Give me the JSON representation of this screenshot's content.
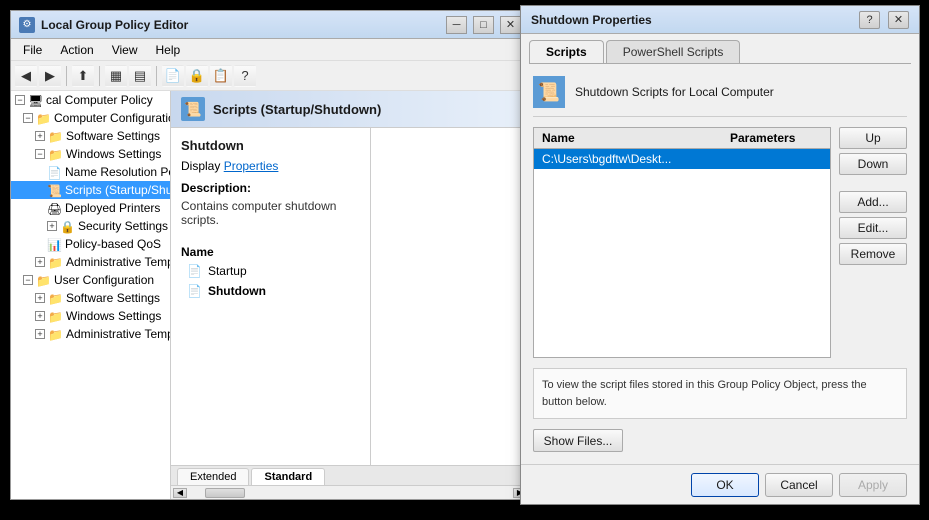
{
  "mainWindow": {
    "title": "Local Group Policy Editor",
    "icon": "⚙"
  },
  "menuBar": {
    "items": [
      "File",
      "Action",
      "View",
      "Help"
    ]
  },
  "toolbar": {
    "buttons": [
      "◀",
      "▶",
      "⬆",
      "📋",
      "⬛",
      "▣",
      "▤",
      "📁",
      "🔒",
      "🔓",
      "👁",
      "🖥"
    ]
  },
  "sidebar": {
    "items": [
      {
        "id": "local-computer-policy",
        "label": "Local Computer Policy",
        "indent": 0,
        "expanded": true,
        "hasTree": false
      },
      {
        "id": "computer-configuration",
        "label": "Computer Configuration",
        "indent": 1,
        "expanded": true,
        "hasTree": true
      },
      {
        "id": "software-settings-computer",
        "label": "Software Settings",
        "indent": 2,
        "expanded": false,
        "hasTree": true
      },
      {
        "id": "windows-settings-computer",
        "label": "Windows Settings",
        "indent": 2,
        "expanded": true,
        "hasTree": true
      },
      {
        "id": "name-resolution",
        "label": "Name Resolution Pol...",
        "indent": 3,
        "expanded": false,
        "hasTree": false
      },
      {
        "id": "scripts",
        "label": "Scripts (Startup/Shu...",
        "indent": 3,
        "expanded": false,
        "hasTree": false,
        "selected": true
      },
      {
        "id": "deployed-printers",
        "label": "Deployed Printers",
        "indent": 3,
        "expanded": false,
        "hasTree": false
      },
      {
        "id": "security-settings",
        "label": "Security Settings",
        "indent": 3,
        "expanded": false,
        "hasTree": true
      },
      {
        "id": "policy-based-qos",
        "label": "Policy-based QoS",
        "indent": 3,
        "expanded": false,
        "hasTree": false
      },
      {
        "id": "admin-templates-computer",
        "label": "Administrative Templat...",
        "indent": 2,
        "expanded": false,
        "hasTree": true
      },
      {
        "id": "user-configuration",
        "label": "User Configuration",
        "indent": 1,
        "expanded": true,
        "hasTree": true
      },
      {
        "id": "software-settings-user",
        "label": "Software Settings",
        "indent": 2,
        "expanded": false,
        "hasTree": true
      },
      {
        "id": "windows-settings-user",
        "label": "Windows Settings",
        "indent": 2,
        "expanded": false,
        "hasTree": true
      },
      {
        "id": "admin-templates-user",
        "label": "Administrative Templat...",
        "indent": 2,
        "expanded": false,
        "hasTree": true
      }
    ]
  },
  "panelHeader": {
    "title": "Scripts (Startup/Shutdown)",
    "icon": "📜"
  },
  "scriptPanel": {
    "sectionTitle": "Shutdown",
    "displayLabel": "Display",
    "propertiesLink": "Properties",
    "descriptionLabel": "Description:",
    "descriptionText": "Contains computer shutdown scripts.",
    "nameLabel": "Name",
    "items": [
      {
        "label": "Startup",
        "icon": "📄"
      },
      {
        "label": "Shutdown",
        "icon": "📄",
        "active": true
      }
    ]
  },
  "statusTabs": [
    {
      "label": "Extended",
      "active": false
    },
    {
      "label": "Standard",
      "active": true
    }
  ],
  "dialog": {
    "title": "Shutdown Properties",
    "helpBtn": "?",
    "closeBtn": "✕",
    "tabs": [
      {
        "label": "Scripts",
        "active": true
      },
      {
        "label": "PowerShell Scripts",
        "active": false
      }
    ],
    "headerLabel": "Shutdown Scripts for Local Computer",
    "headerIcon": "📜",
    "tableColumns": {
      "name": "Name",
      "parameters": "Parameters"
    },
    "tableRows": [
      {
        "name": "C:\\Users\\bgdftw\\Deskt...",
        "parameters": "",
        "selected": true
      }
    ],
    "actionButtons": [
      {
        "label": "Up",
        "disabled": false
      },
      {
        "label": "Down",
        "disabled": false
      },
      {
        "label": "Add...",
        "disabled": false
      },
      {
        "label": "Edit...",
        "disabled": false
      },
      {
        "label": "Remove",
        "disabled": false
      }
    ],
    "infoText": "To view the script files stored in this Group Policy Object, press the button below.",
    "showFilesBtn": "Show Files...",
    "footerButtons": [
      {
        "label": "OK",
        "primary": true,
        "disabled": false
      },
      {
        "label": "Cancel",
        "primary": false,
        "disabled": false
      },
      {
        "label": "Apply",
        "primary": false,
        "disabled": true
      }
    ]
  }
}
